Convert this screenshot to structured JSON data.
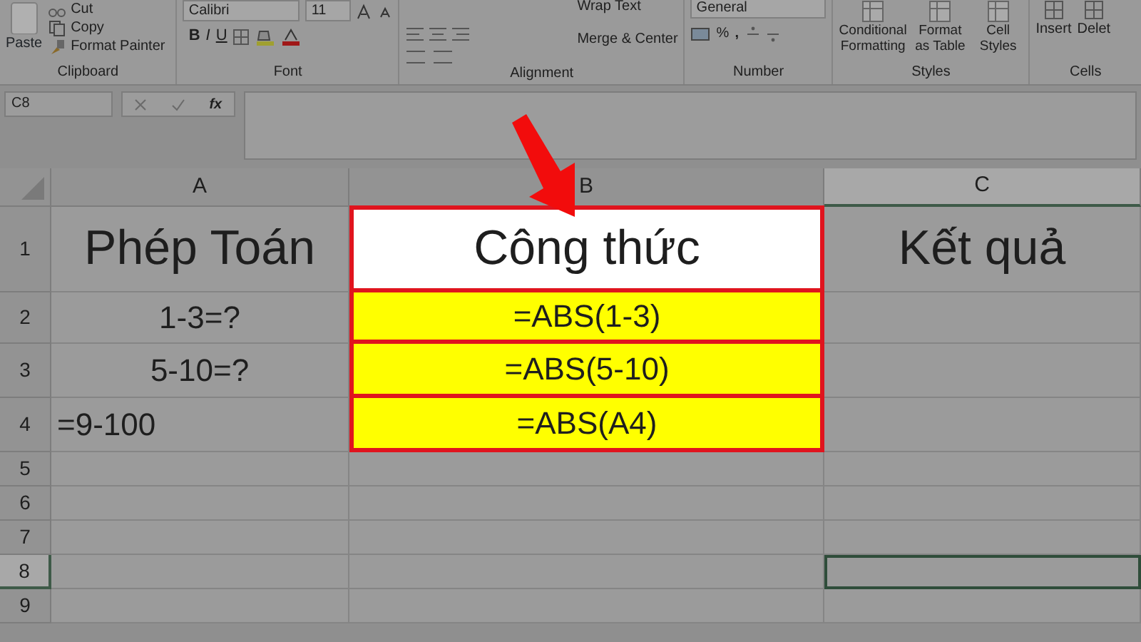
{
  "ribbon": {
    "clipboard": {
      "paste": "Paste",
      "cut": "Cut",
      "copy": "Copy",
      "format_painter": "Format Painter",
      "label": "Clipboard"
    },
    "font": {
      "name": "Calibri",
      "size": "11",
      "bold": "B",
      "italic": "I",
      "underline": "U",
      "label": "Font"
    },
    "alignment": {
      "wrap": "Wrap Text",
      "merge": "Merge & Center",
      "label": "Alignment"
    },
    "number": {
      "format": "General",
      "percent": "%",
      "comma": ",",
      "label": "Number"
    },
    "styles": {
      "conditional": "Conditional Formatting",
      "format_table": "Format as Table",
      "cell_styles": "Cell Styles",
      "label": "Styles"
    },
    "cells": {
      "insert": "Insert",
      "delete": "Delet",
      "label": "Cells"
    }
  },
  "formula_bar": {
    "name_box": "C8",
    "fx": "fx"
  },
  "columns": [
    {
      "label": "A",
      "selected": false
    },
    {
      "label": "B",
      "selected": false
    },
    {
      "label": "C",
      "selected": true
    }
  ],
  "rows": [
    {
      "number": "1",
      "selected": false,
      "cells": [
        {
          "text": "Phép Toán",
          "kind": "heading",
          "highlighted": false,
          "selected": false
        },
        {
          "text": "Công thức",
          "kind": "heading",
          "highlighted": true,
          "selected": false
        },
        {
          "text": "Kết quả",
          "kind": "heading",
          "highlighted": false,
          "selected": false
        }
      ]
    },
    {
      "number": "2",
      "selected": false,
      "cells": [
        {
          "text": "1-3=?",
          "kind": "value",
          "highlighted": false,
          "selected": false
        },
        {
          "text": "=ABS(1-3)",
          "kind": "value",
          "highlighted": true,
          "selected": false
        },
        {
          "highlighted": false,
          "selected": false
        }
      ]
    },
    {
      "number": "3",
      "selected": false,
      "cells": [
        {
          "text": "5-10=?",
          "kind": "value",
          "highlighted": false,
          "selected": false
        },
        {
          "text": "=ABS(5-10)",
          "kind": "value",
          "highlighted": true,
          "selected": false
        },
        {
          "highlighted": false,
          "selected": false
        }
      ]
    },
    {
      "number": "4",
      "selected": false,
      "cells": [
        {
          "text": "=9-100",
          "kind": "entry",
          "highlighted": false,
          "selected": false
        },
        {
          "text": "=ABS(A4)",
          "kind": "value",
          "highlighted": true,
          "selected": false
        },
        {
          "highlighted": false,
          "selected": false
        }
      ]
    },
    {
      "number": "5",
      "selected": false,
      "cells": [
        {
          "highlighted": false,
          "selected": false
        },
        {
          "highlighted": false,
          "selected": false
        },
        {
          "highlighted": false,
          "selected": false
        }
      ]
    },
    {
      "number": "6",
      "selected": false,
      "cells": [
        {
          "highlighted": false,
          "selected": false
        },
        {
          "highlighted": false,
          "selected": false
        },
        {
          "highlighted": false,
          "selected": false
        }
      ]
    },
    {
      "number": "7",
      "selected": false,
      "cells": [
        {
          "highlighted": false,
          "selected": false
        },
        {
          "highlighted": false,
          "selected": false
        },
        {
          "highlighted": false,
          "selected": false
        }
      ]
    },
    {
      "number": "8",
      "selected": true,
      "cells": [
        {
          "highlighted": false,
          "selected": false
        },
        {
          "highlighted": false,
          "selected": false
        },
        {
          "highlighted": false,
          "selected": true
        }
      ]
    },
    {
      "number": "9",
      "selected": false,
      "cells": [
        {
          "highlighted": false,
          "selected": false
        },
        {
          "highlighted": false,
          "selected": false
        },
        {
          "highlighted": false,
          "selected": false
        }
      ]
    }
  ]
}
